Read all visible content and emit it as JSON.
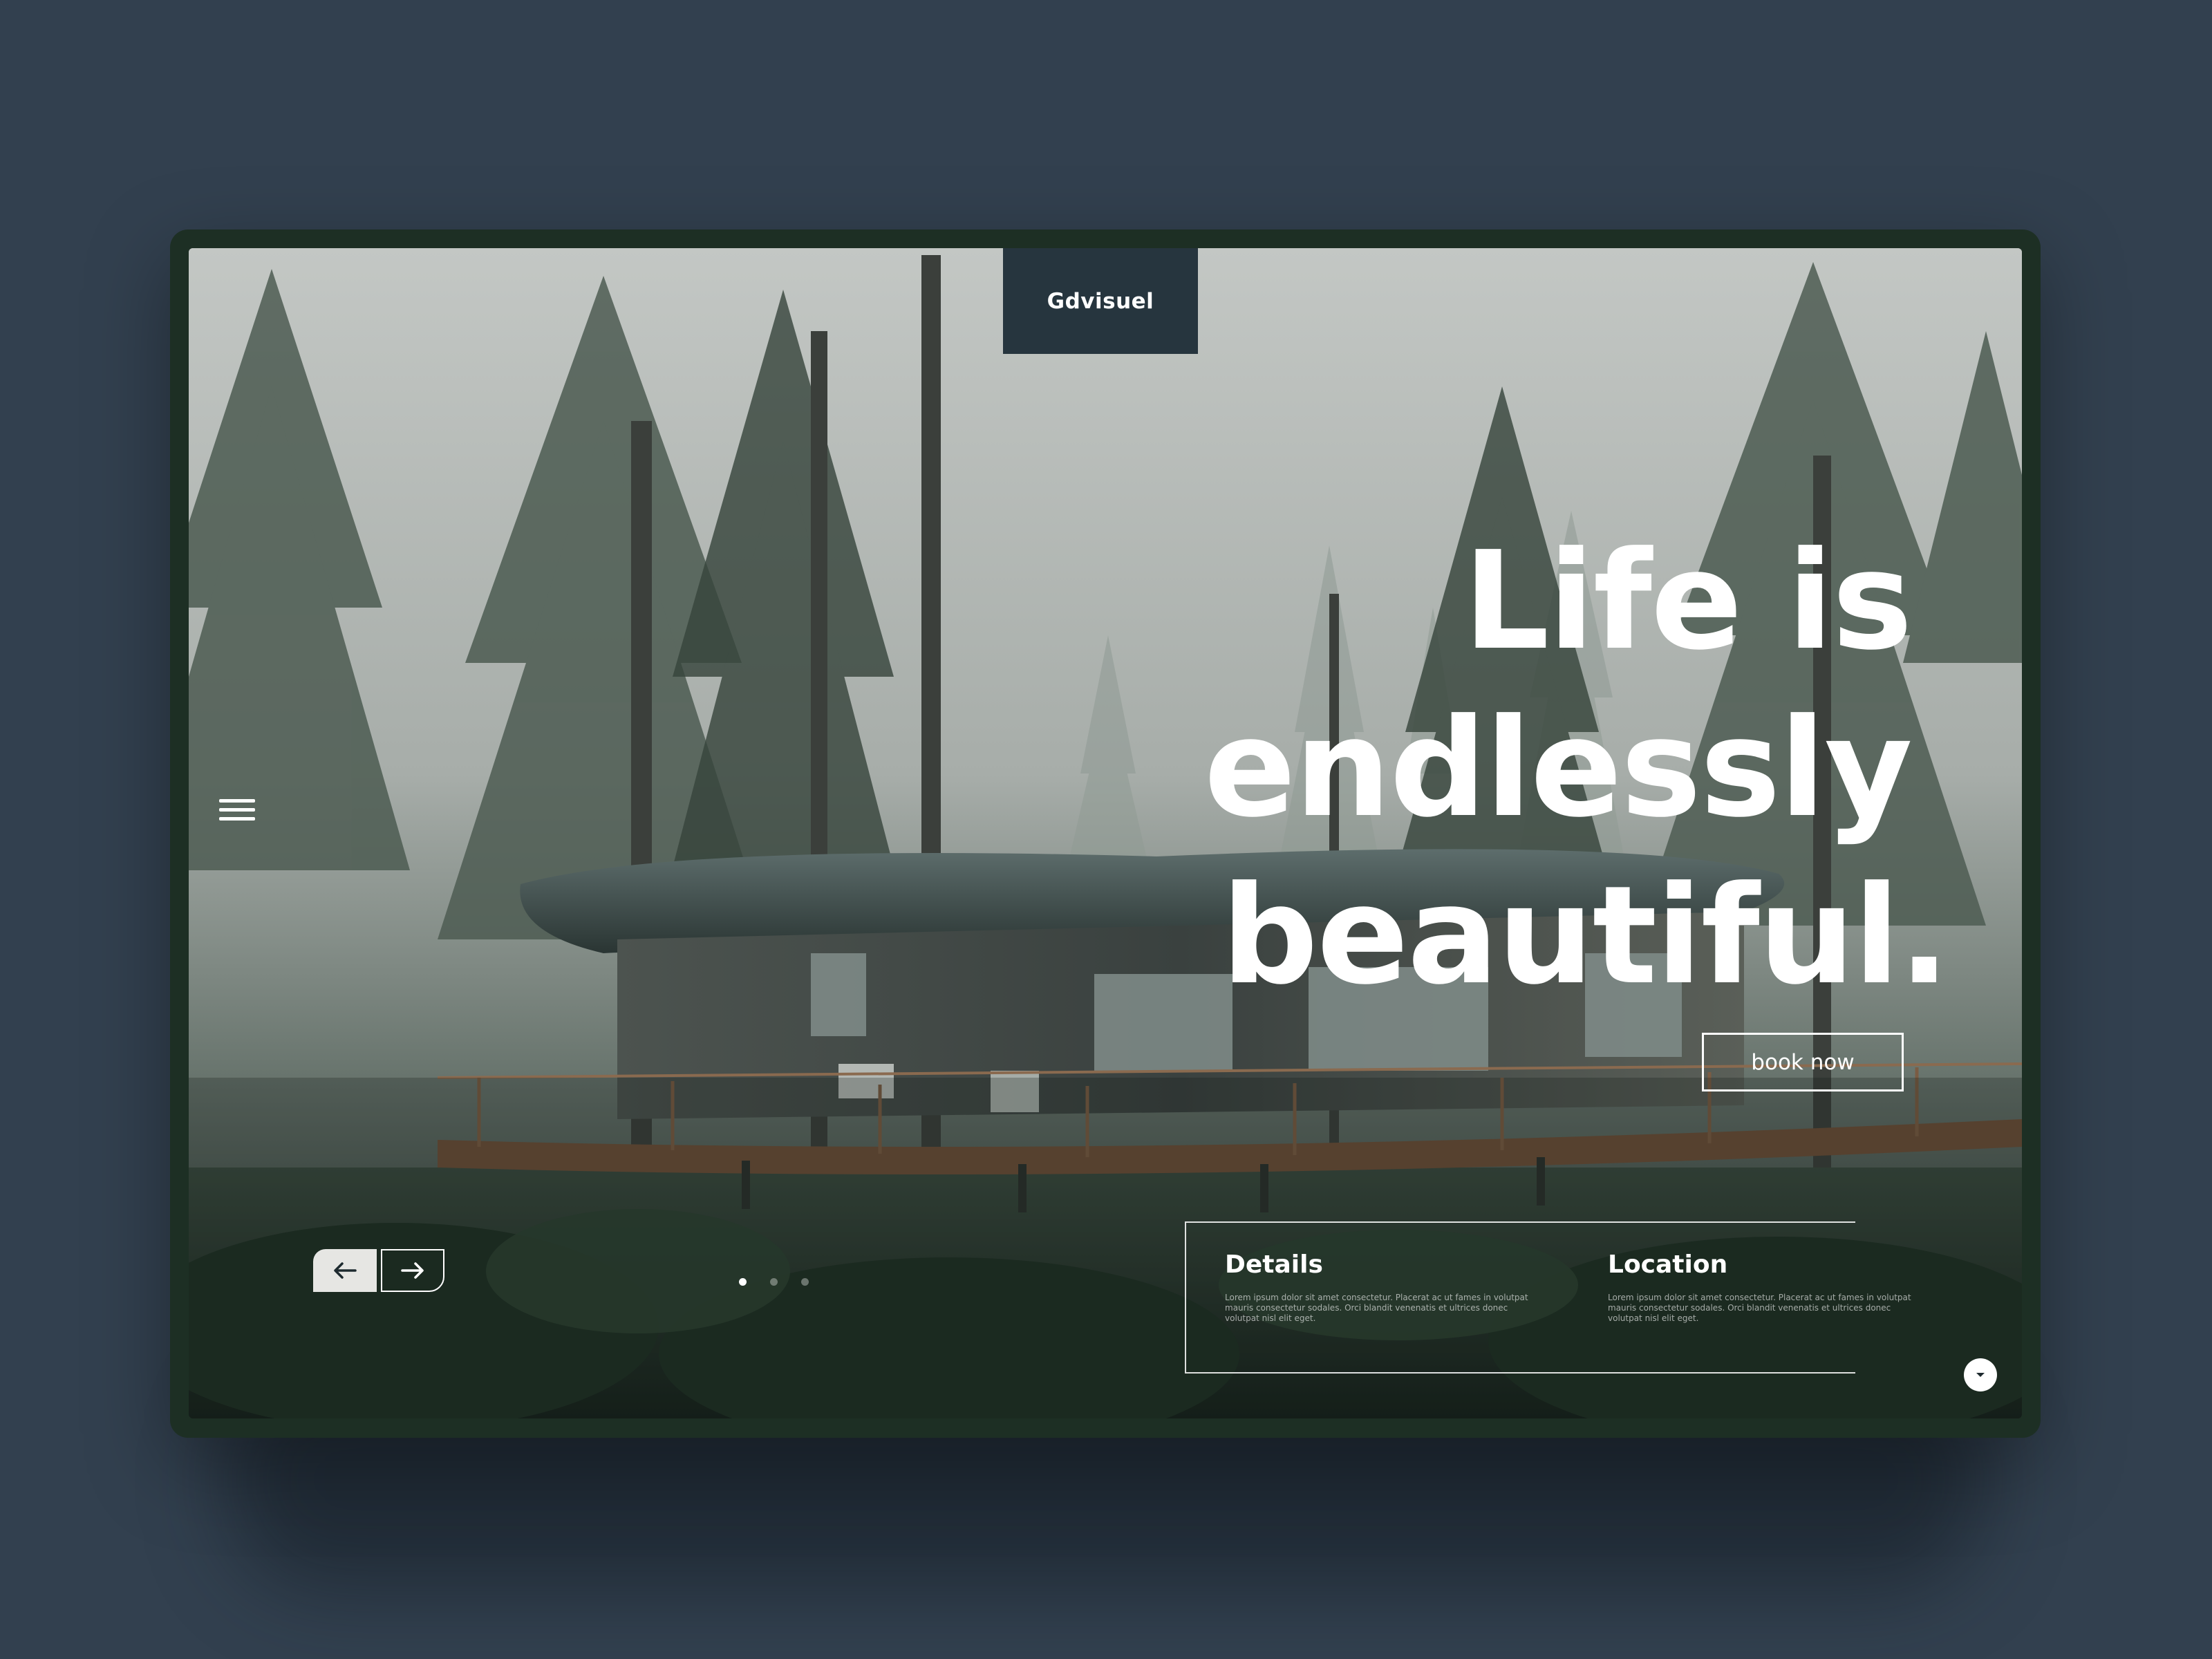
{
  "brand": {
    "name": "Gdvisuel"
  },
  "hero": {
    "headline_lines": [
      "Life is",
      "endlessly",
      "beautiful."
    ],
    "book_button_label": "book now"
  },
  "navigation": {
    "menu_icon": "hamburger-menu-icon",
    "prev_icon": "arrow-left-icon",
    "next_icon": "arrow-right-icon",
    "scroll_icon": "chevron-down-icon",
    "slide_count": 3,
    "active_slide": 1
  },
  "info": {
    "details": {
      "title": "Details",
      "text": "Lorem ipsum dolor sit amet consectetur. Placerat ac ut fames in volutpat mauris consectetur sodales. Orci blandit venenatis et ultrices donec volutpat nisl elit eget."
    },
    "location": {
      "title": "Location",
      "text": "Lorem ipsum dolor sit amet consectetur. Placerat ac ut fames in volutpat mauris consectetur sodales. Orci blandit venenatis et ultrices donec volutpat nisl elit eget."
    }
  },
  "colors": {
    "page_background": "#32404f",
    "frame": "#1d2f24",
    "brand_tab": "#26353e",
    "text_light": "#ffffff"
  }
}
